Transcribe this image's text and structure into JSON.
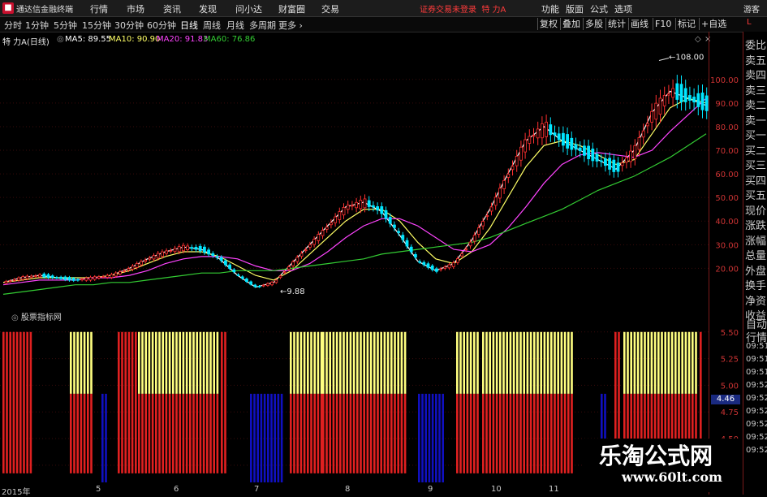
{
  "menubar": {
    "app_title": "通达信金融终端",
    "items": [
      "行情",
      "市场",
      "资讯",
      "发现",
      "问小达",
      "财富圈",
      "交易"
    ],
    "notice": "证券交易未登录",
    "stock_name": "特 力A",
    "right_items": [
      "功能",
      "版面",
      "公式",
      "选项"
    ],
    "guest": "游客"
  },
  "toolbar": {
    "periods": [
      "分时",
      "1分钟",
      "5分钟",
      "15分钟",
      "30分钟",
      "60分钟",
      "日线",
      "周线",
      "月线",
      "多周期",
      "更多"
    ],
    "active_period": "日线",
    "buttons": [
      "复权",
      "叠加",
      "多股",
      "统计",
      "画线",
      "F10",
      "标记",
      "+自选"
    ]
  },
  "legend": {
    "stock": "特 力A",
    "period_tag": "(日线)",
    "ma5": "MA5: 89.55",
    "ma10": "MA10: 90.90",
    "ma20": "MA20: 91.83",
    "ma60": "MA60: 76.86"
  },
  "colors": {
    "ma5": "#ffffff",
    "ma10": "#ffff66",
    "ma20": "#ff44ff",
    "ma60": "#33cc33",
    "up": "#ff3030",
    "down": "#00e5ff",
    "yellow_bar": "#ffff80",
    "red_bar": "#e02020",
    "blue_bar": "#1010c0"
  },
  "chart_data": [
    {
      "type": "candlestick",
      "title": "特 力A (日线)",
      "y_ticks": [
        "100.00",
        "90.00",
        "80.00",
        "70.00",
        "60.00",
        "50.00",
        "40.00",
        "30.00",
        "20.00"
      ],
      "ylim": [
        5,
        113
      ],
      "annotations": [
        {
          "label": "108.00",
          "value": 108
        },
        {
          "label": "9.88",
          "value": 9.88
        }
      ],
      "series": [
        {
          "name": "MA5",
          "values": [
            14,
            16,
            17,
            16,
            15,
            16,
            17,
            20,
            24,
            27,
            29,
            28,
            24,
            17,
            12,
            14,
            22,
            30,
            38,
            46,
            48,
            44,
            34,
            23,
            19,
            22,
            32,
            45,
            60,
            74,
            80,
            74,
            70,
            66,
            62,
            70,
            86,
            95,
            92,
            89
          ]
        },
        {
          "name": "MA10",
          "values": [
            14,
            15,
            16,
            16,
            16,
            16,
            17,
            19,
            22,
            25,
            27,
            27,
            25,
            21,
            17,
            15,
            19,
            26,
            33,
            40,
            45,
            45,
            40,
            31,
            24,
            22,
            27,
            37,
            50,
            63,
            72,
            74,
            72,
            68,
            64,
            66,
            77,
            88,
            92,
            90
          ]
        },
        {
          "name": "MA20",
          "values": [
            13,
            14,
            15,
            15,
            15,
            16,
            16,
            17,
            19,
            22,
            24,
            25,
            25,
            24,
            21,
            19,
            19,
            22,
            27,
            33,
            38,
            41,
            41,
            38,
            33,
            28,
            27,
            30,
            37,
            46,
            56,
            64,
            68,
            69,
            68,
            67,
            70,
            78,
            85,
            92
          ]
        },
        {
          "name": "MA60",
          "values": [
            9,
            10,
            11,
            12,
            13,
            13,
            14,
            14,
            15,
            16,
            17,
            18,
            18,
            19,
            19,
            19,
            20,
            21,
            22,
            23,
            24,
            26,
            27,
            28,
            29,
            30,
            31,
            33,
            36,
            39,
            42,
            45,
            49,
            53,
            56,
            59,
            63,
            67,
            72,
            77
          ]
        }
      ]
    },
    {
      "type": "bar",
      "title": "股票指标网",
      "y_ticks": [
        "5.50",
        "5.25",
        "5.00",
        "4.75",
        "4.50",
        "4.25"
      ],
      "ylim": [
        4.15,
        5.62
      ],
      "price_badge": "4.46"
    }
  ],
  "quote_panel": {
    "rows": [
      "委比",
      "卖五",
      "卖四",
      "卖三",
      "卖二",
      "卖一",
      "买一",
      "买二",
      "买三",
      "买四",
      "买五",
      "现价",
      "涨跌",
      "涨幅",
      "总量",
      "外盘",
      "换手",
      "净资",
      "收益"
    ]
  },
  "lower_panel": {
    "rows": [
      "自动",
      "行情",
      "09:51",
      "09:51",
      "09:51",
      "09:52",
      "09:52",
      "09:52",
      "09:52",
      "09:52",
      "09:52"
    ]
  },
  "corner_label": "L",
  "x_labels": [
    "2015年",
    "5",
    "6",
    "7",
    "8",
    "9",
    "10",
    "11"
  ],
  "watermark": {
    "line1": "乐淘公式网",
    "line2": "www.60lt.com"
  }
}
